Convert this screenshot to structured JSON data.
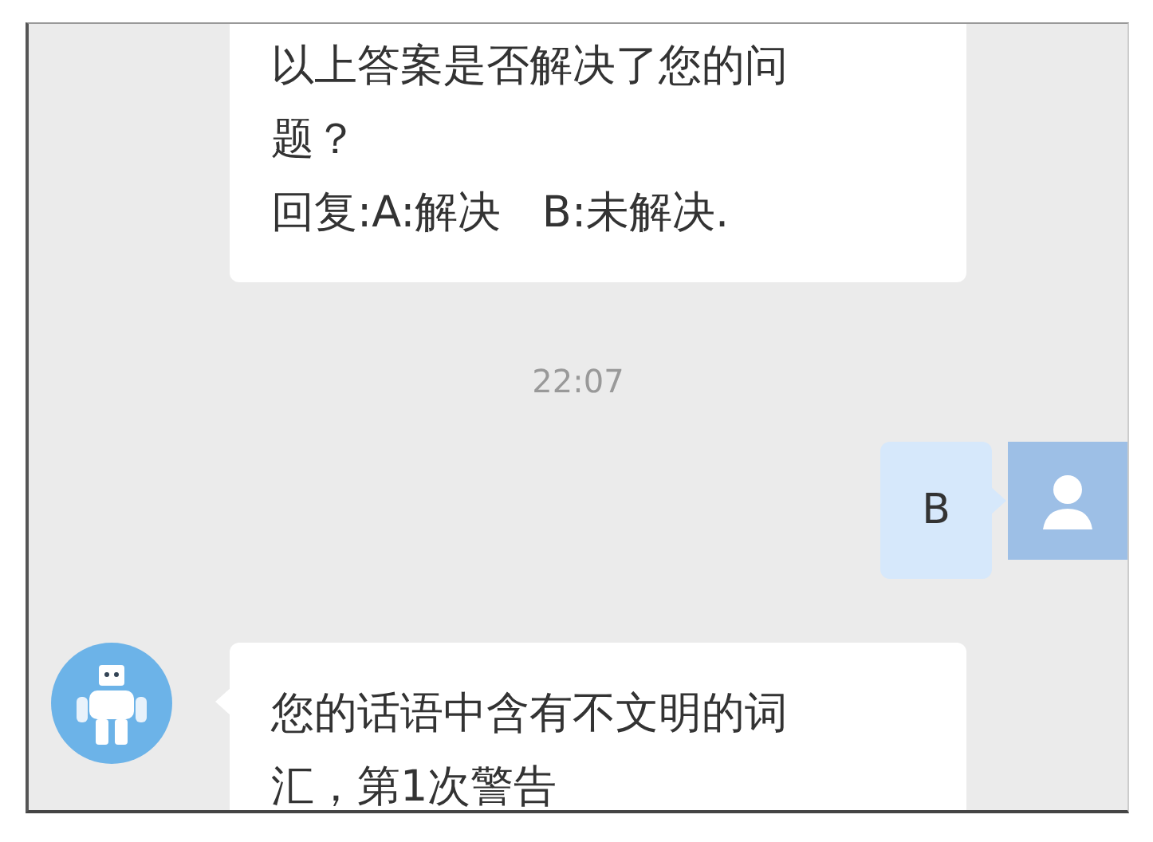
{
  "messages": [
    {
      "kind": "incoming",
      "lines": [
        "以上答案是否解决了您的问题？",
        "回复:A:解决   B:未解决."
      ],
      "avatar_shown": false
    },
    {
      "kind": "time",
      "text": "22:07"
    },
    {
      "kind": "outgoing",
      "lines": [
        "B"
      ],
      "avatar_shown": true
    },
    {
      "kind": "incoming",
      "lines": [
        "您的话语中含有不文明的词汇，第1次警告"
      ],
      "avatar_shown": true
    }
  ]
}
